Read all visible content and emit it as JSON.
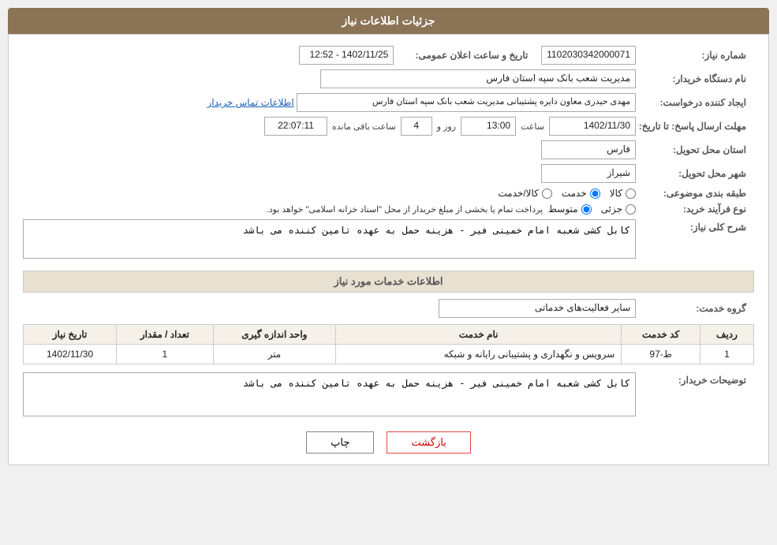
{
  "header": {
    "title": "جزئیات اطلاعات نیاز"
  },
  "fields": {
    "need_number_label": "شماره نیاز:",
    "need_number_value": "1102030342000071",
    "announcement_label": "تاریخ و ساعت اعلان عمومی:",
    "announcement_value": "1402/11/25 - 12:52",
    "buyer_name_label": "نام دستگاه خریدار:",
    "buyer_name_value": "مدیریت شعب بانک سپه استان فارس",
    "creator_label": "ایجاد کننده درخواست:",
    "creator_value": "مهدی حیدری معاون دایره پشتیبانی مدیریت شعب بانک سپه استان فارس",
    "contact_link": "اطلاعات تماس خریدار",
    "reply_deadline_label": "مهلت ارسال پاسخ: تا تاریخ:",
    "reply_date_value": "1402/11/30",
    "reply_time_label": "ساعت",
    "reply_time_value": "13:00",
    "reply_days_label": "روز و",
    "reply_days_value": "4",
    "remaining_label": "ساعت باقی مانده",
    "remaining_value": "22:07:11",
    "province_label": "استان محل تحویل:",
    "province_value": "فارس",
    "city_label": "شهر محل تحویل:",
    "city_value": "شیراز",
    "category_label": "طبقه بندی موضوعی:",
    "category_options": [
      {
        "label": "کالا",
        "value": "kala"
      },
      {
        "label": "خدمت",
        "value": "khedmat"
      },
      {
        "label": "کالا/خدمت",
        "value": "kala_khedmat"
      }
    ],
    "category_selected": "khedmat",
    "purchase_type_label": "نوع فرآیند خرید:",
    "purchase_type_options": [
      {
        "label": "جزئی",
        "value": "jozi"
      },
      {
        "label": "متوسط",
        "value": "motavasset"
      }
    ],
    "purchase_type_selected": "motavasset",
    "purchase_type_note": "پرداخت تمام یا بخشی از مبلغ خریدار از محل \"اسناد خزانه اسلامی\" خواهد بود.",
    "need_description_label": "شرح کلی نیاز:",
    "need_description_value": "کابل کشی شعبه امام خمینی فیر - هزینه حمل به عهده تامین کننده می باشد",
    "services_section_title": "اطلاعات خدمات مورد نیاز",
    "service_group_label": "گروه خدمت:",
    "service_group_value": "سایر فعالیت‌های خدماتی",
    "table_headers": [
      "ردیف",
      "کد خدمت",
      "نام خدمت",
      "واحد اندازه گیری",
      "تعداد / مقدار",
      "تاریخ نیاز"
    ],
    "table_rows": [
      {
        "row": "1",
        "code": "ط-97",
        "name": "سرویس و نگهداری و پشتیبانی رایانه و شبکه",
        "unit": "متر",
        "qty": "1",
        "date": "1402/11/30"
      }
    ],
    "buyer_description_label": "توضیحات خریدار:",
    "buyer_description_value": "کابل کشی شعبه امام خمینی فیر - هزینه حمل به عهده تامین کننده می باشد",
    "btn_print": "چاپ",
    "btn_back": "بازگشت"
  }
}
